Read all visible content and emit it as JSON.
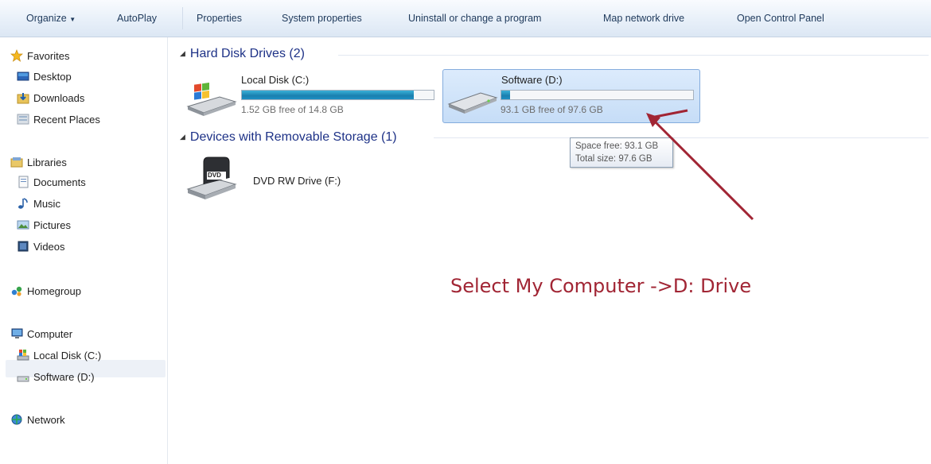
{
  "toolbar": {
    "items": [
      "Organize",
      "AutoPlay",
      "Properties",
      "System properties",
      "Uninstall or change a program",
      "Map network drive",
      "Open Control Panel"
    ],
    "organize_arrow": "▼"
  },
  "sidebar": {
    "favorites": {
      "label": "Favorites",
      "items": [
        "Desktop",
        "Downloads",
        "Recent Places"
      ]
    },
    "libraries": {
      "label": "Libraries",
      "items": [
        "Documents",
        "Music",
        "Pictures",
        "Videos"
      ]
    },
    "homegroup": {
      "label": "Homegroup"
    },
    "computer": {
      "label": "Computer",
      "items": [
        "Local Disk (C:)",
        "Software (D:)"
      ]
    },
    "network": {
      "label": "Network"
    }
  },
  "groups": {
    "hard_disks": {
      "title": "Hard Disk Drives (2)",
      "drives": [
        {
          "name": "Local Disk (C:)",
          "free_text": "1.52 GB free of 14.8 GB",
          "used_fraction": 0.897
        },
        {
          "name": "Software (D:)",
          "free_text": "93.1 GB free of 97.6 GB",
          "used_fraction": 0.046
        }
      ]
    },
    "removable": {
      "title": "Devices with Removable Storage (1)",
      "devices": [
        {
          "name": "DVD RW Drive (F:)",
          "icon_text": "DVD"
        }
      ]
    }
  },
  "tooltip": {
    "line1": "Space free: 93.1 GB",
    "line2": "Total size: 97.6 GB"
  },
  "annotation": {
    "text": "Select My Computer ->D: Drive",
    "color": "#a12534"
  }
}
